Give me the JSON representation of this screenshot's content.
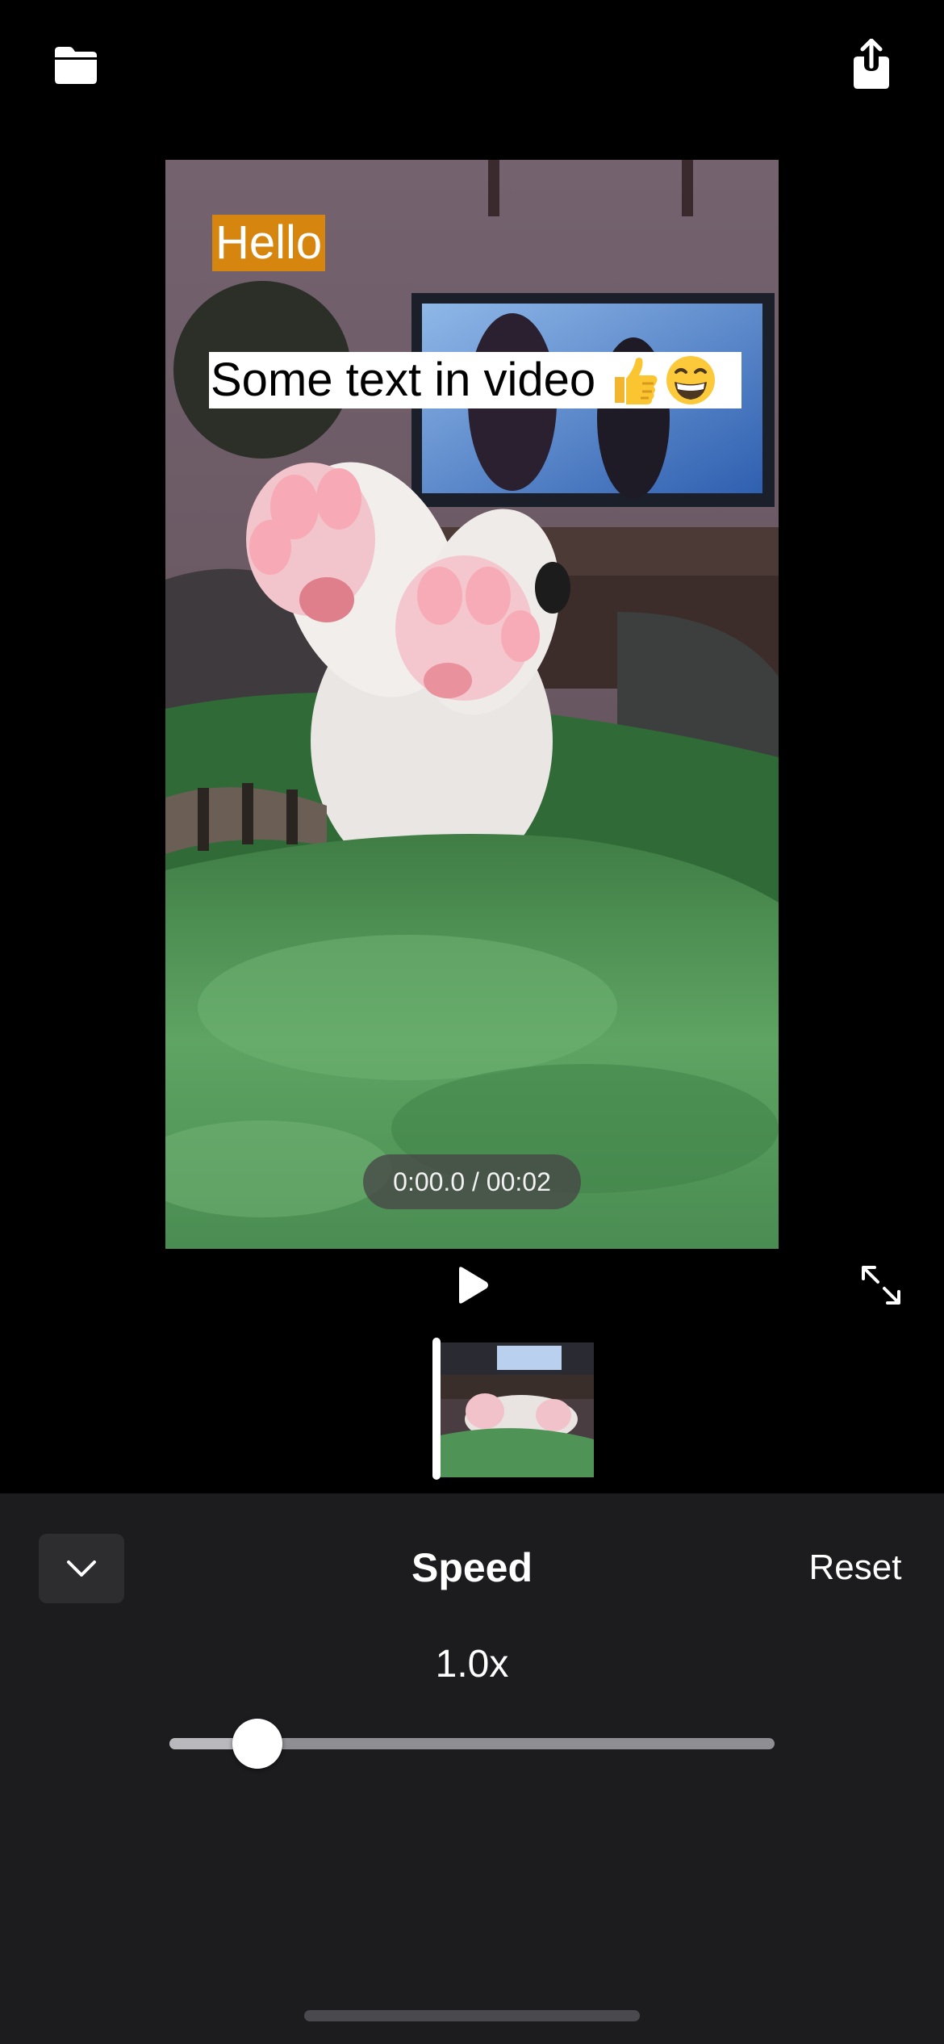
{
  "toolbar": {
    "open_icon": "folder-icon",
    "share_icon": "share-icon"
  },
  "video": {
    "overlay_hello": "Hello",
    "overlay_caption": "Some text in video",
    "overlay_caption_emoji": "👍😁",
    "time_display": "0:00.0 / 00:02",
    "overlay_hello_color": "#d6860e"
  },
  "controls": {
    "play_icon": "play-icon",
    "fullscreen_icon": "expand-icon"
  },
  "panel": {
    "collapse_icon": "chevron-down-icon",
    "title": "Speed",
    "reset_label": "Reset",
    "speed_value": "1.0x",
    "slider_fraction": 0.145
  }
}
